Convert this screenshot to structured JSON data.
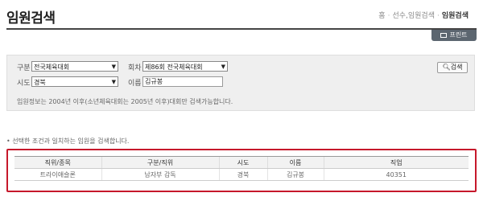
{
  "header": {
    "title": "임원검색",
    "breadcrumb": [
      "홈",
      "선수,임원검색",
      "임원검색"
    ],
    "print_label": "프린트"
  },
  "search": {
    "category_label": "구분",
    "category_value": "전국체육대회",
    "session_label": "회차",
    "session_value": "제86회 전국체육대회",
    "region_label": "시도",
    "region_value": "경북",
    "name_label": "이름",
    "name_value": "김규봉",
    "search_button": "검색",
    "notice": "임원정보는 2004년 이후(소년체육대회는 2005년 이후)대회만 검색가능합니다."
  },
  "result_note": "• 선택한 조건과 일치하는 임원을 검색합니다.",
  "table": {
    "headers": [
      "직위/종목",
      "구분/직위",
      "시도",
      "이름",
      "직업"
    ],
    "rows": [
      [
        "트라이애슬론",
        "남자부 감독",
        "경북",
        "김규봉",
        "40351"
      ]
    ]
  }
}
